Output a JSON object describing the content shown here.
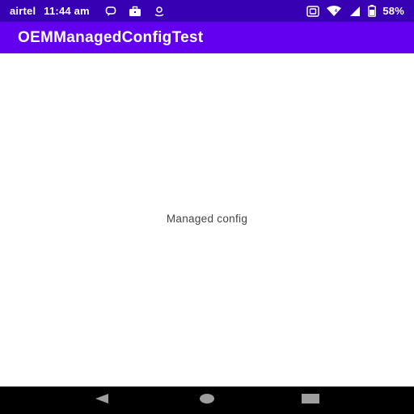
{
  "status_bar": {
    "carrier": "airtel",
    "time": "11:44 am",
    "battery": "58%",
    "icons": [
      "message-icon",
      "briefcase-icon",
      "location-icon",
      "hotspot-icon",
      "wifi-icon",
      "signal-icon",
      "battery-icon"
    ]
  },
  "app_bar": {
    "title": "OEMManagedConfigTest"
  },
  "main": {
    "text": "Managed config"
  },
  "nav_bar": {
    "buttons": [
      "back-icon",
      "home-icon",
      "recents-icon"
    ]
  },
  "colors": {
    "status_bar": "#3700b3",
    "app_bar": "#6200ee",
    "nav_bar": "#000000",
    "background": "#ffffff"
  }
}
